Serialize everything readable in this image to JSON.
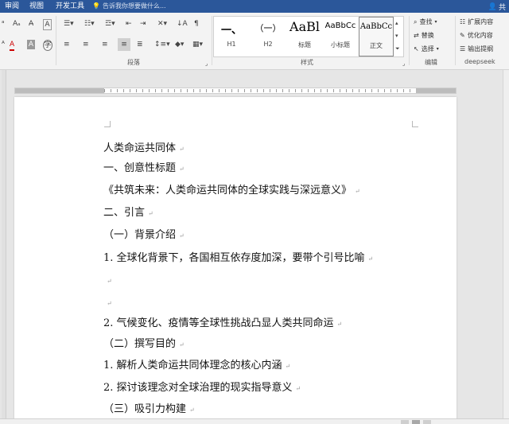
{
  "tabs": {
    "review": "审阅",
    "view": "视图",
    "developer": "开发工具",
    "tell_me": "告诉我你想要做什么..."
  },
  "user_glyph": "共",
  "ribbon": {
    "paragraph_group": "段落",
    "styles_group": "样式",
    "editing_group": "编辑",
    "ext_group": "deepseek",
    "styles": [
      {
        "preview": "一、",
        "name": "H1"
      },
      {
        "preview": "（一）",
        "name": "H2"
      },
      {
        "preview": "AaBl",
        "name": "标题"
      },
      {
        "preview": "AaBbCc",
        "name": "小标题"
      },
      {
        "preview": "AaBbCc",
        "name": "正文"
      }
    ],
    "editing": {
      "find": "查找",
      "replace": "替换",
      "select": "选择"
    },
    "ext": {
      "expand": "扩展内容",
      "optimize": "优化内容",
      "outline": "输出提纲"
    }
  },
  "document": {
    "lines": [
      "人类命运共同体",
      "一、创意性标题",
      "《共筑未来：人类命运共同体的全球实践与深远意义》",
      "二、引言",
      "（一）背景介绍",
      "1. 全球化背景下，各国相互依存度加深，要带个引号比喻",
      "",
      "",
      "2. 气候变化、疫情等全球性挑战凸显人类共同命运",
      "（二）撰写目的",
      "1. 解析人类命运共同体理念的核心内涵",
      "2. 探讨该理念对全球治理的现实指导意义",
      "（三）吸引力构建"
    ]
  }
}
